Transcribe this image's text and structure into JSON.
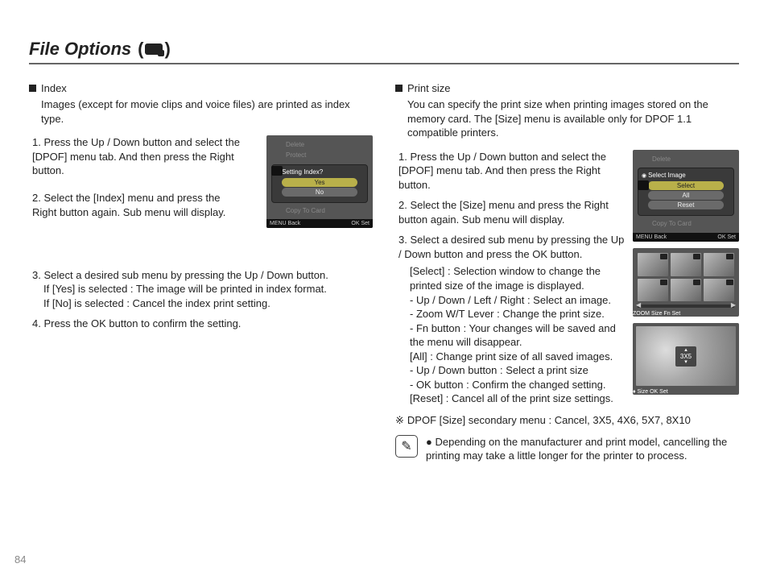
{
  "title": "File Options",
  "title_paren_open": "(",
  "title_paren_close": ")",
  "page_number": "84",
  "left": {
    "head": "Index",
    "desc": "Images (except for movie clips and voice files) are printed as index type.",
    "steps": [
      "1. Press the Up / Down button and select the [DPOF] menu tab. And then press the Right button.",
      "2. Select the [Index] menu and press the Right button again. Sub menu will display.",
      "3. Select a desired sub menu by pressing the Up / Down button.",
      "4. Press the OK button to confirm the setting."
    ],
    "step3_yes": "If [Yes] is selected : The image will be printed in index format.",
    "step3_no": "If [No] is selected  : Cancel the index print setting.",
    "shot": {
      "menu_items": [
        "Delete",
        "Protect",
        "",
        "Copy To Card"
      ],
      "panel_title": "Setting Index?",
      "opt_yes": "Yes",
      "opt_no": "No",
      "bar_left": "MENU Back",
      "bar_right": "OK  Set"
    }
  },
  "right": {
    "head": "Print size",
    "desc": "You can specify the print size when printing images stored on the memory card. The [Size] menu is available only for DPOF 1.1 compatible printers.",
    "steps": [
      "1. Press the Up / Down button and select the [DPOF] menu tab. And then press the Right button.",
      "2. Select the [Size] menu and press the Right button again. Sub menu will display.",
      "3. Select a desired sub menu by pressing the Up / Down button and press the OK button."
    ],
    "select_lead": "[Select] : Selection window to change the printed size of the image is displayed.",
    "select_sub": [
      "- Up / Down / Left / Right : Select an image.",
      "- Zoom W/T Lever : Change the print size.",
      "- Fn button : Your changes will be saved and the menu will disappear."
    ],
    "all_lead": "[All] : Change print size of all saved images.",
    "all_sub": [
      "- Up / Down button : Select a print size",
      "- OK button : Confirm the changed setting."
    ],
    "reset": "[Reset] : Cancel all of the print size settings.",
    "secondary": "DPOF [Size] secondary menu : Cancel, 3X5, 4X6, 5X7, 8X10",
    "note": "Depending on the manufacturer and print model, cancelling the printing may take a little longer for the printer to process.",
    "shot1": {
      "menu_items": [
        "Delete",
        "",
        "",
        "Copy To Card"
      ],
      "panel_title": "Select Image",
      "opt_select": "Select",
      "opt_all": "All",
      "opt_reset": "Reset",
      "bar_left": "MENU Back",
      "bar_right": "OK  Set"
    },
    "shot2": {
      "bar_left": "ZOOM Size",
      "bar_right": "Fn  Set"
    },
    "shot3": {
      "overlay": "3X5",
      "bar_left": "♦ Size",
      "bar_right": "OK  Set"
    }
  }
}
